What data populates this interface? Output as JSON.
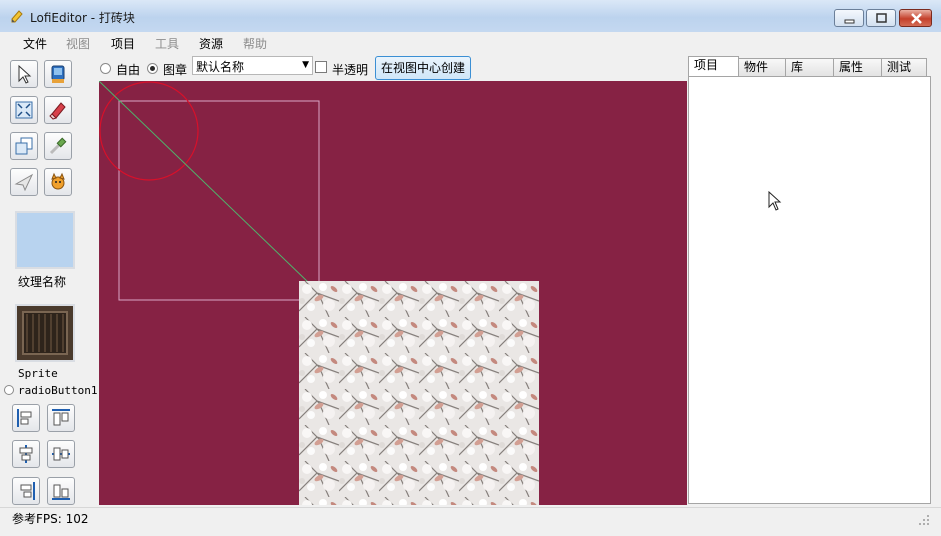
{
  "window": {
    "title": "LofiEditor - 打砖块",
    "icon": "app-pencil-icon",
    "controls": [
      "minimize-icon",
      "maximize-icon",
      "close-icon"
    ]
  },
  "menu": {
    "file": "文件",
    "view": "视图",
    "project": "项目",
    "tools": "工具",
    "resources": "资源",
    "help": "帮助"
  },
  "toolbar": {
    "tools": [
      "select-arrow-icon",
      "paint-bucket-icon",
      "fit-view-icon",
      "eraser-icon",
      "layers-icon",
      "eyedropper-icon",
      "paper-plane-icon",
      "cat-sprite-icon"
    ],
    "texture_label": "纹理名称",
    "texture_color": "#b8d3ef",
    "sprite_label": "Sprite",
    "radio_label": "radioButton1",
    "align_buttons": [
      "align-left-icon",
      "align-top-icon",
      "align-center-v-icon",
      "align-center-h-icon",
      "align-right-icon",
      "align-bottom-icon"
    ]
  },
  "options": {
    "free_label": "自由",
    "stamp_label": "图章",
    "mode_selected": "stamp",
    "name_combo_value": "默认名称",
    "semi_transparent_label": "半透明",
    "semi_transparent_checked": false,
    "create_center_button": "在视图中心创建"
  },
  "canvas": {
    "background": "#862244"
  },
  "panel": {
    "tabs": [
      "项目",
      "物件",
      "库",
      "属性",
      "测试"
    ],
    "active_tab": "项目"
  },
  "status": {
    "fps_text": "参考FPS: 102"
  }
}
